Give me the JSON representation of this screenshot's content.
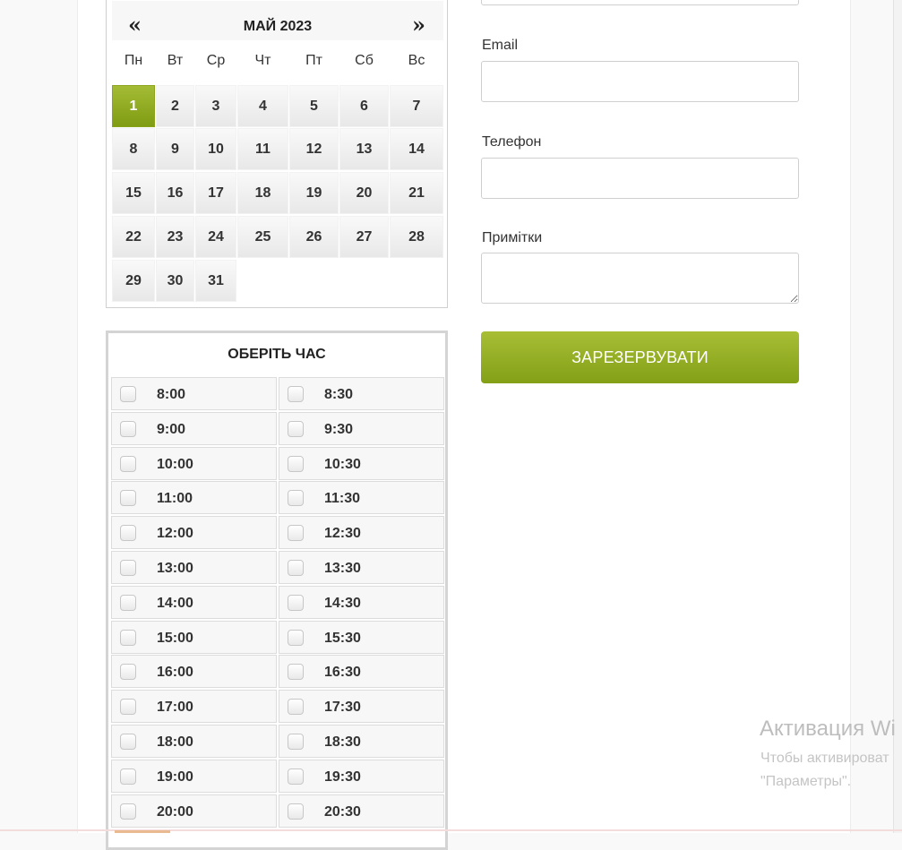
{
  "calendar": {
    "month_title": "МАЙ 2023",
    "prev": "«",
    "next": "»",
    "weekdays": [
      "Пн",
      "Вт",
      "Ср",
      "Чт",
      "Пт",
      "Сб",
      "Вс"
    ],
    "days": [
      "1",
      "2",
      "3",
      "4",
      "5",
      "6",
      "7",
      "8",
      "9",
      "10",
      "11",
      "12",
      "13",
      "14",
      "15",
      "16",
      "17",
      "18",
      "19",
      "20",
      "21",
      "22",
      "23",
      "24",
      "25",
      "26",
      "27",
      "28",
      "29",
      "30",
      "31"
    ],
    "selected_day": "1",
    "active_color": "#8fab1e"
  },
  "time_panel": {
    "title": "ОБЕРІТЬ ЧАС",
    "slots": [
      "8:00",
      "8:30",
      "9:00",
      "9:30",
      "10:00",
      "10:30",
      "11:00",
      "11:30",
      "12:00",
      "12:30",
      "13:00",
      "13:30",
      "14:00",
      "14:30",
      "15:00",
      "15:30",
      "16:00",
      "16:30",
      "17:00",
      "17:30",
      "18:00",
      "18:30",
      "19:00",
      "19:30",
      "20:00",
      "20:30"
    ]
  },
  "form": {
    "email_label": "Email",
    "email_value": "",
    "phone_label": "Телефон",
    "phone_value": "",
    "notes_label": "Примітки",
    "notes_value": "",
    "submit_label": "ЗАРЕЗЕРВУВАТИ",
    "accent_color": "#95b024"
  },
  "watermark": {
    "title": "Активация Wi",
    "line1": "Чтобы активироват",
    "line2": "\"Параметры\"."
  }
}
